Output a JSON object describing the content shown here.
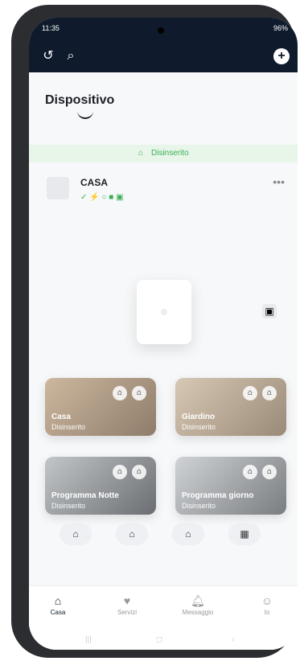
{
  "status_bar": {
    "time": "11:35",
    "signals": "96%"
  },
  "topbar": {
    "back_icon": "history-icon",
    "search_icon": "search-icon",
    "add_icon": "plus-icon"
  },
  "page": {
    "title": "Dispositivo"
  },
  "status_band": {
    "text": "Disinserito",
    "color": "#3cae54"
  },
  "device": {
    "name": "CASA",
    "more": "•••",
    "indicators": [
      "✓",
      "⚡",
      "○",
      "■",
      "▣"
    ]
  },
  "cards": [
    {
      "name": "Casa",
      "subtitle": "Disinserito"
    },
    {
      "name": "Giardino",
      "subtitle": "Disinserito"
    },
    {
      "name": "Programma Notte",
      "subtitle": "Disinserito"
    },
    {
      "name": "Programma giorno",
      "subtitle": "Disinserito"
    }
  ],
  "controls": [
    "home-arm-icon",
    "home-icon",
    "home-alt-icon",
    "building-icon"
  ],
  "bottom_nav": [
    {
      "label": "Casa",
      "icon": "home-icon",
      "active": true
    },
    {
      "label": "Servizi",
      "icon": "heart-icon",
      "active": false
    },
    {
      "label": "Messaggio",
      "icon": "bell-icon",
      "active": false
    },
    {
      "label": "Io",
      "icon": "user-icon",
      "active": false
    }
  ]
}
